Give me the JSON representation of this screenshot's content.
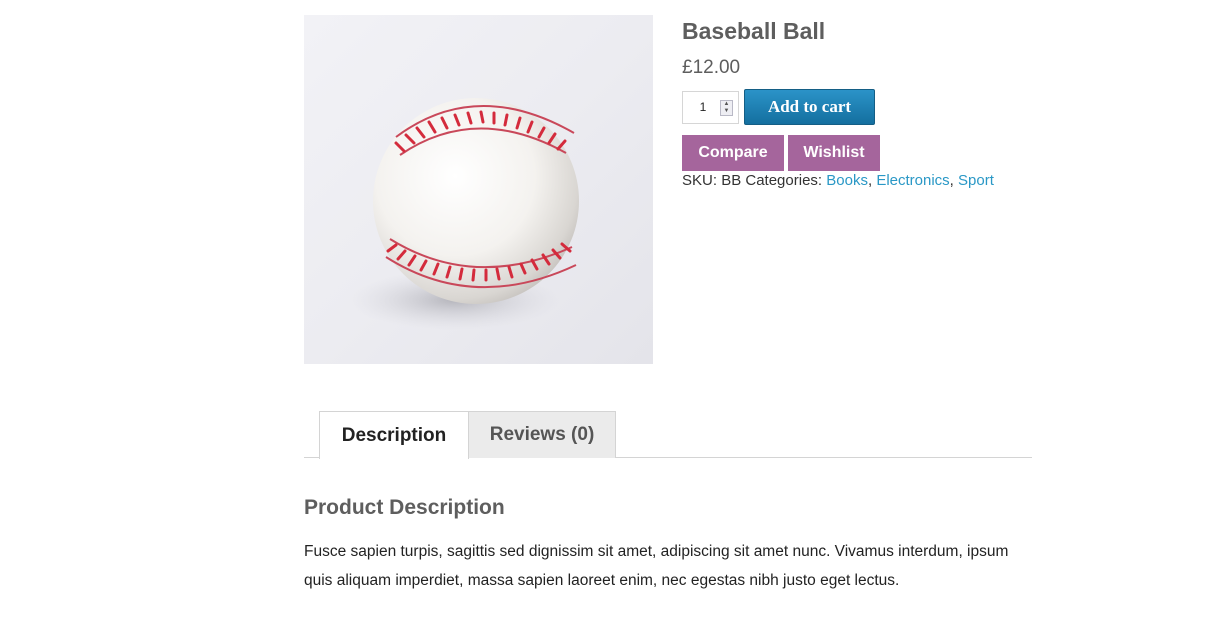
{
  "product": {
    "title": "Baseball Ball",
    "price": "£12.00",
    "image_icon": "baseball-image",
    "quantity": "1",
    "add_to_cart_label": "Add to cart",
    "compare_label": "Compare",
    "wishlist_label": "Wishlist",
    "sku_label": "SKU:",
    "sku_value": "BB",
    "categories_label": "Categories:",
    "categories": [
      "Books",
      "Electronics",
      "Sport"
    ]
  },
  "tabs": [
    {
      "label": "Description",
      "active": true
    },
    {
      "label": "Reviews (0)",
      "active": false
    }
  ],
  "description": {
    "heading": "Product Description",
    "text": "Fusce sapien turpis, sagittis sed dignissim sit amet, adipiscing sit amet nunc. Vivamus interdum, ipsum quis aliquam imperdiet, massa sapien laoreet enim, nec egestas nibh justo eget lectus."
  },
  "colors": {
    "cart_button": "#1a7fb3",
    "purple_button": "#a5659c",
    "link": "#2a98c6"
  }
}
